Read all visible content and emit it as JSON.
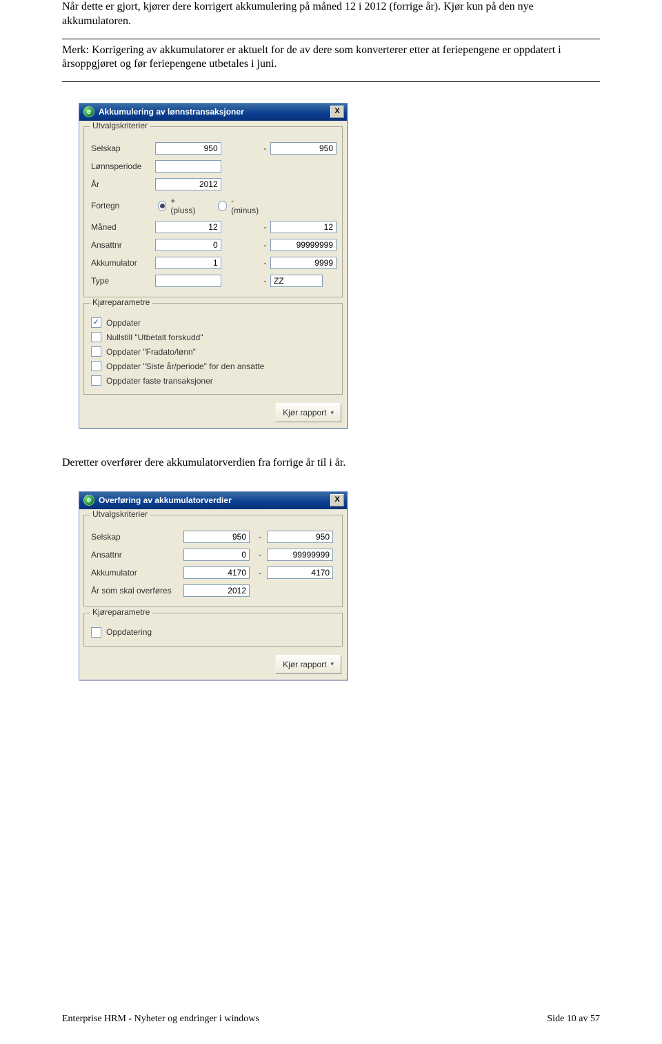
{
  "paragraphs": {
    "p1": "Når dette er gjort, kjører dere korrigert akkumulering på måned 12 i 2012 (forrige år). Kjør kun på den nye akkumulatoren.",
    "p2": "Merk: Korrigering av akkumulatorer er aktuelt for de av dere som konverterer etter at feriepengene er oppdatert i årsoppgjøret og før feriepengene utbetales i juni.",
    "p3": "Deretter overfører dere akkumulatorverdien fra forrige år til i år."
  },
  "dialog1": {
    "icon_letter": "e",
    "title": "Akkumulering av lønnstransaksjoner",
    "close": "X",
    "group1_legend": "Utvalgskriterier",
    "labels": {
      "selskap": "Selskap",
      "lonnsperiode": "Lønnsperiode",
      "aar": "År",
      "fortegn": "Fortegn",
      "maned": "Måned",
      "ansattnr": "Ansattnr",
      "akkumulator": "Akkumulator",
      "type": "Type"
    },
    "radio": {
      "plus": "+ (pluss)",
      "minus": "- (minus)"
    },
    "values": {
      "selskap_from": "950",
      "selskap_to": "950",
      "lonnsperiode": "",
      "aar": "2012",
      "maned_from": "12",
      "maned_to": "12",
      "ansattnr_from": "0",
      "ansattnr_to": "99999999",
      "akkumulator_from": "1",
      "akkumulator_to": "9999",
      "type_from": "",
      "type_to": "ZZ"
    },
    "group2_legend": "Kjøreparametre",
    "checks": {
      "c1": "Oppdater",
      "c2": "Nullstill \"Utbetalt forskudd\"",
      "c3": "Oppdater \"Fradato/lønn\"",
      "c4": "Oppdater \"Siste år/periode\" for den ansatte",
      "c5": "Oppdater faste transaksjoner"
    },
    "run_button": "Kjør rapport"
  },
  "dialog2": {
    "icon_letter": "e",
    "title": "Overføring av akkumulatorverdier",
    "close": "X",
    "group1_legend": "Utvalgskriterier",
    "labels": {
      "selskap": "Selskap",
      "ansattnr": "Ansattnr",
      "akkumulator": "Akkumulator",
      "aar_overfor": "År som skal overføres"
    },
    "values": {
      "selskap_from": "950",
      "selskap_to": "950",
      "ansattnr_from": "0",
      "ansattnr_to": "99999999",
      "akk_from": "4170",
      "akk_to": "4170",
      "aar": "2012"
    },
    "group2_legend": "Kjøreparametre",
    "checks": {
      "c1": "Oppdatering"
    },
    "run_button": "Kjør rapport"
  },
  "footer": {
    "left": "Enterprise HRM - Nyheter og endringer i windows",
    "right": "Side 10 av 57"
  }
}
